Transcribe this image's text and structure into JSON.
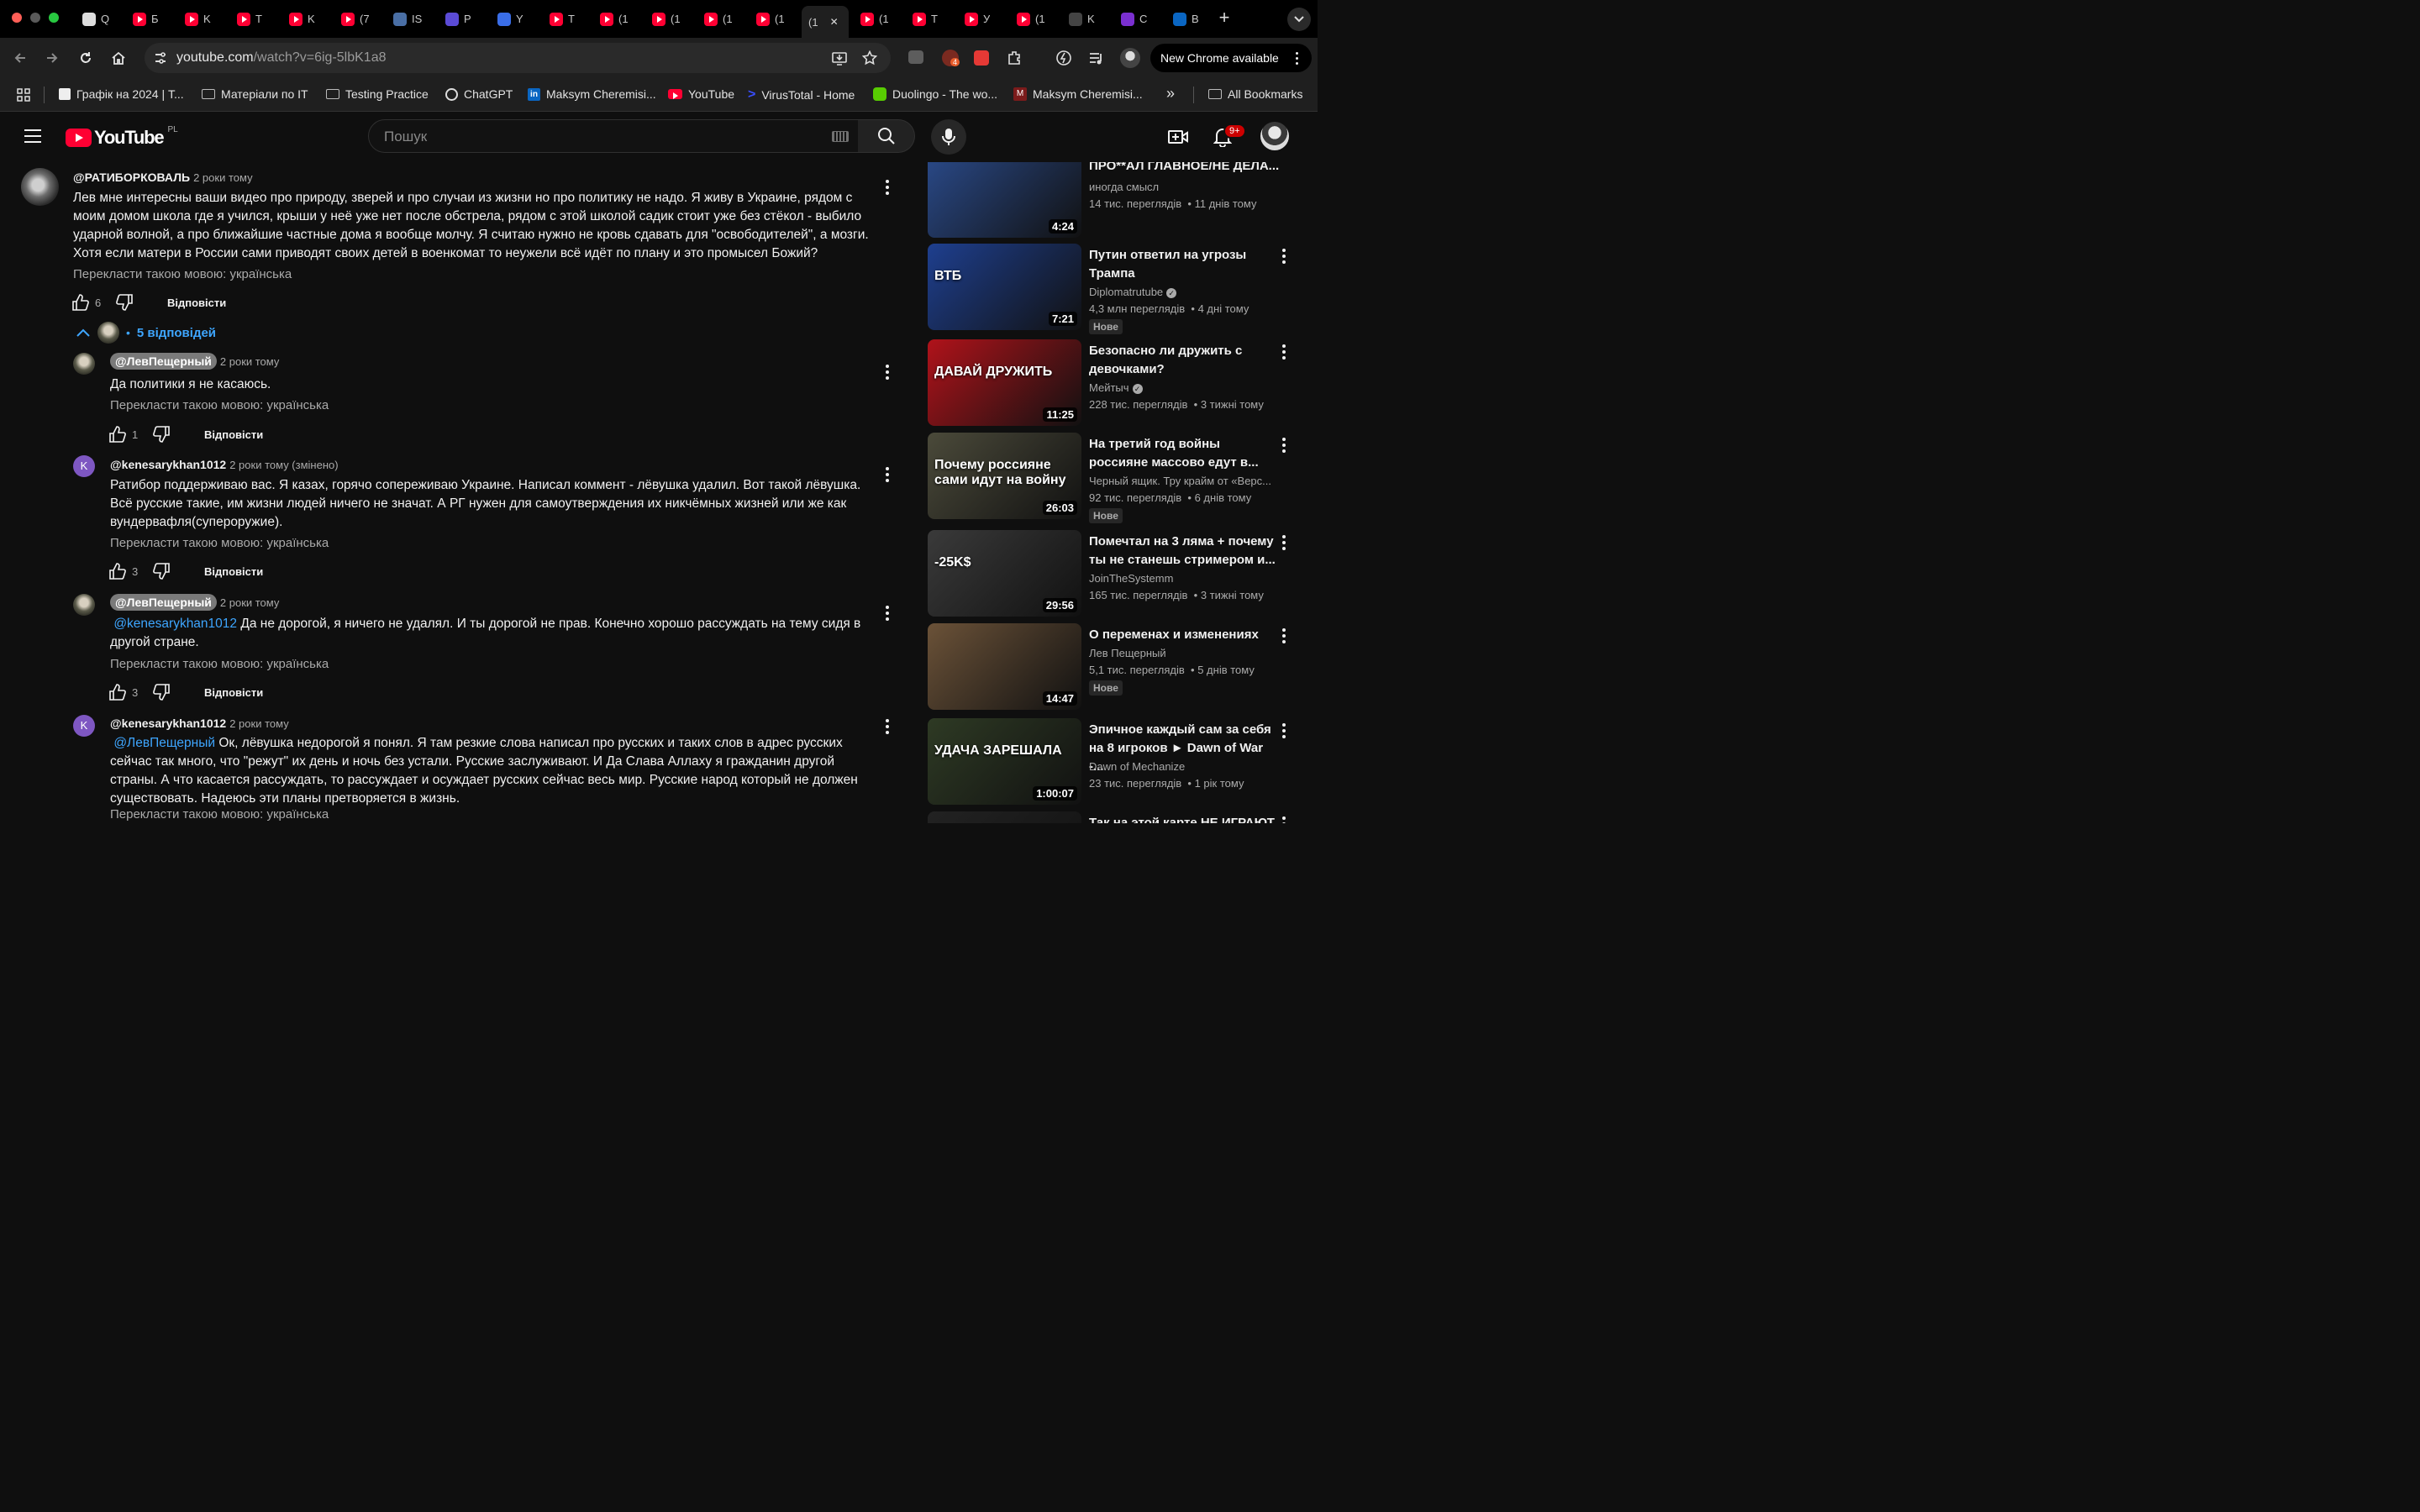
{
  "browser": {
    "tabs": [
      "Q",
      "Б",
      "K",
      "T",
      "K",
      "(7",
      "IS",
      "P",
      "Y",
      "T",
      "(1",
      "(1",
      "(1",
      "(1",
      "(1",
      "(1",
      "T",
      "У",
      "(1",
      "K",
      "C",
      "B"
    ],
    "url_host": "youtube.com",
    "url_path": "/watch?v=6ig-5lbK1a8",
    "new_chrome": "New Chrome available",
    "extension_badge": "4"
  },
  "bookmarks": {
    "items": [
      "Графік на 2024 | Т...",
      "Матеріали по IT",
      "Testing Practice",
      "ChatGPT",
      "Maksym Cheremisi...",
      "YouTube",
      "VirusTotal - Home",
      "Duolingo - The wo...",
      "Maksym Cheremisi..."
    ],
    "overflow": "»",
    "all": "All Bookmarks"
  },
  "youtube": {
    "logo_text": "YouTube",
    "region": "PL",
    "search_placeholder": "Пошук",
    "notif_count": "9+"
  },
  "comments": [
    {
      "author": "@РАТИБОРКОВАЛЬ",
      "time": "2 роки тому",
      "text": "Лев мне интересны ваши видео про природу, зверей и про случаи из жизни но про политику не надо. Я живу в Украине, рядом с моим домом школа где я учился, крыши у неё уже нет после  обстрела, рядом с этой школой садик стоит уже без стёкол - выбило ударной волной, а про ближайшие частные дома я вообще молчу. Я считаю нужно не кровь сдавать для \"освободителей\", а мозги. Хотя если матери в России сами приводят своих детей в военкомат то неужели всё идёт по плану и это промысел Божий?",
      "translate": "Перекласти такою мовою: українська",
      "likes": "6",
      "reply": "Відповісти"
    },
    {
      "author": "@ЛевПещерный",
      "time": "2 роки тому",
      "text": "Да политики я не касаюсь.",
      "translate": "Перекласти такою мовою: українська",
      "likes": "1",
      "reply": "Відповісти"
    },
    {
      "author": "@kenesarykhan1012",
      "time": "2 роки тому (змінено)",
      "text": "Ратибор поддерживаю вас. Я казах, горячо сопереживаю Украине. Написал коммент -  лёвушка удалил. Вот такой лёвушка. Всё русские такие, им жизни людей ничего не значат. А РГ нужен для самоутверждения их никчёмных жизней или же как вундервафля(супероружие).",
      "translate": "Перекласти такою мовою: українська",
      "likes": "3",
      "reply": "Відповісти",
      "avatar_letter": "K"
    },
    {
      "author": "@ЛевПещерный",
      "time": "2 роки тому",
      "mention": "@kenesarykhan1012",
      "text": " Да не дорогой, я ничего не удалял. И ты дорогой не прав.  Конечно хорошо рассуждать на тему сидя в другой стране.",
      "translate": "Перекласти такою мовою: українська",
      "likes": "3",
      "reply": "Відповісти"
    },
    {
      "author": "@kenesarykhan1012",
      "time": "2 роки тому",
      "mention": "@ЛевПещерный",
      "text": "  Ок, лёвушка недорогой я понял. Я там резкие слова написал про русских и таких слов в адрес русских сейчас так много, что \"режут\" их день и ночь без устали. Русские заслуживают. И Да Слава Аллаху я гражданин другой страны. А что касается рассуждать, то рассуждает и осуждает русских сейчас весь мир. Русские народ который не должен существовать. Надеюсь эти планы претворяется в жизнь.",
      "translate": "Перекласти такою мовою: українська",
      "avatar_letter": "K"
    }
  ],
  "replies_toggle": "5 відповідей",
  "sidebar": [
    {
      "title": "ПРО**АЛ ГЛАВНОЕ/НЕ ДЕЛА...",
      "channel": "иногда смысл",
      "views": "14 тис. переглядів",
      "age": "11 днів тому",
      "duration": "4:24",
      "color": "#2a4a8a"
    },
    {
      "title": "Путин ответил на угрозы Трампа",
      "channel": "Diplomatrutube",
      "views": "4,3 млн переглядів",
      "age": "4 дні тому",
      "duration": "7:21",
      "badge": "Нове",
      "color": "#1e3f8f",
      "thumb_text": "ВТБ"
    },
    {
      "title": "Безопасно ли дружить с девочками?",
      "channel": "Мейтыч",
      "views": "228 тис. переглядів",
      "age": "3 тижні тому",
      "duration": "11:25",
      "color": "#b0121a",
      "thumb_text": "ДАВАЙ ДРУЖИТЬ"
    },
    {
      "title": "На третий год войны россияне массово едут в...",
      "channel": "Черный ящик. Тру крайм от «Верс...",
      "views": "92 тис. переглядів",
      "age": "6 днів тому",
      "duration": "26:03",
      "badge": "Нове",
      "color": "#4b4a3a",
      "thumb_text": "Почему россияне сами идут на войну"
    },
    {
      "title": "Помечтал на 3 ляма + почему ты не станешь стримером и...",
      "channel": "JoinTheSystemm",
      "views": "165 тис. переглядів",
      "age": "3 тижні тому",
      "duration": "29:56",
      "color": "#3a3a3a",
      "thumb_text": "-25K$"
    },
    {
      "title": "О переменах и изменениях",
      "channel": "Лев Пещерный",
      "views": "5,1 тис. переглядів",
      "age": "5 днів тому",
      "duration": "14:47",
      "badge": "Нове",
      "color": "#6b5238"
    },
    {
      "title": "Эпичное каждый сам за себя на 8 игроков ► Dawn of War -...",
      "channel": "Dawn of Mechanize",
      "views": "23 тис. переглядів",
      "age": "1 рік тому",
      "duration": "1:00:07",
      "color": "#2e3a24",
      "thumb_text": "УДАЧА ЗАРЕШАЛА"
    },
    {
      "title": "Так на этой карте НЕ ИГРАЮТ",
      "color": "#222"
    }
  ]
}
